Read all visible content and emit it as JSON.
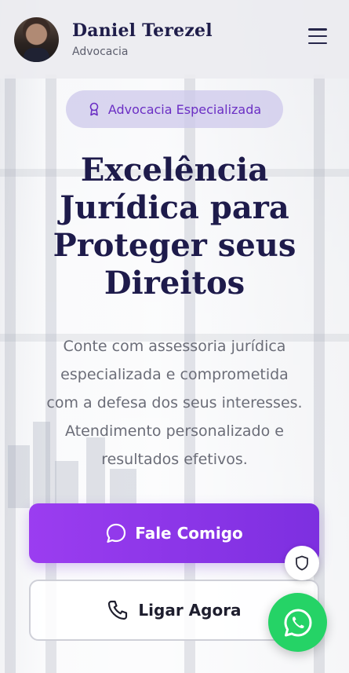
{
  "header": {
    "name": "Daniel Terezel",
    "subtitle": "Advocacia"
  },
  "hero": {
    "badge": "Advocacia Especializada",
    "title_lines": [
      "Excelência",
      "Jurídica para",
      "Proteger seus",
      "Direitos"
    ],
    "description_lines": [
      "Conte com assessoria jurídica",
      "especializada e comprometida",
      "com a defesa dos seus interesses.",
      "Atendimento personalizado e",
      "resultados efetivos."
    ]
  },
  "actions": {
    "primary_label": "Fale Comigo",
    "secondary_label": "Ligar Agora"
  },
  "icons": {
    "menu": "menu-icon",
    "badge": "award-icon",
    "chat": "chat-bubble-icon",
    "phone": "phone-icon",
    "shield": "shield-icon",
    "whatsapp": "whatsapp-icon"
  },
  "colors": {
    "primary": "#8b35ea",
    "title": "#1e1b4b",
    "whatsapp": "#25d366"
  }
}
